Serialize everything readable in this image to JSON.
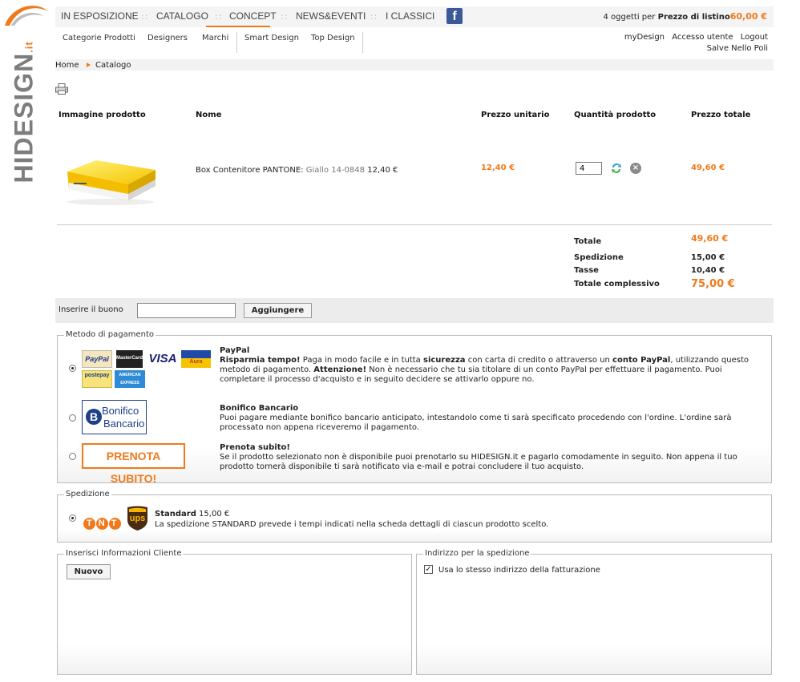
{
  "brand": {
    "name": "HIDESIGN",
    "suffix": ".it",
    "accent": "#f07a1b"
  },
  "topnav": {
    "items": [
      "IN ESPOSIZIONE",
      "CATALOGO",
      "CONCEPT",
      "NEWS&EVENTI",
      "I CLASSICI"
    ],
    "separator": "::",
    "active": "CATALOGO",
    "facebook_glyph": "f"
  },
  "cart": {
    "prefix": "4 oggetti per ",
    "label": "Prezzo di listino",
    "amount": "60,00 €"
  },
  "subnav": {
    "items": [
      "Categorie Prodotti",
      "Designers",
      "Marchi",
      "Smart Design",
      "Top Design"
    ]
  },
  "user": {
    "links": [
      "myDesign",
      "Accesso utente",
      "Logout"
    ],
    "greeting": "Salve Nello Poli"
  },
  "breadcrumb": {
    "home": "Home",
    "current": "Catalogo"
  },
  "table": {
    "headers": [
      "Immagine prodotto",
      "Nome",
      "Prezzo unitario",
      "Quantità prodotto",
      "Prezzo totale"
    ],
    "row": {
      "name": "Box Contenitore PANTONE:",
      "variant": "Giallo 14-0848",
      "inline_price": "12,40 €",
      "unit_price": "12,40 €",
      "quantity": "4",
      "total": "49,60 €"
    }
  },
  "totals": {
    "items": [
      {
        "label": "Totale",
        "value": "49,60 €"
      },
      {
        "label": "Spedizione",
        "value": "15,00 €"
      },
      {
        "label": "Tasse",
        "value": "10,40 €"
      },
      {
        "label": "Totale complessivo",
        "value": "75,00 €"
      }
    ]
  },
  "coupon": {
    "label": "Inserire il buono",
    "button": "Aggiungere",
    "value": ""
  },
  "payment": {
    "legend": "Metodo di pagamento",
    "options": [
      {
        "title": "PayPal",
        "selected": true,
        "text_parts": [
          "Risparmia tempo!",
          " Paga in modo facile e in tutta ",
          "sicurezza",
          " con carta di credito o attraverso un ",
          "conto PayPal",
          ", utilizzando questo metodo di pagamento. ",
          "Attenzione!",
          " Non è necessario che tu sia titolare di un conto PayPal per effettuare il pagamento. Puoi completare il processo d'acquisto e in seguito decidere se attivarlo oppure no."
        ],
        "logos": {
          "paypal": "PayPal",
          "mastercard": "MasterCard",
          "visa": "VISA",
          "aura": "Aura",
          "postepay": "postepay",
          "amex": "AMERICAN EXPRESS"
        }
      },
      {
        "title": "Bonifico Bancario",
        "selected": false,
        "text": "Puoi pagare mediante bonifico bancario anticipato, intestandolo come ti sarà specificato procedendo con l'ordine. L'ordine sarà processato non appena riceveremo il pagamento.",
        "logo": [
          "Bonifico",
          "Bancario"
        ]
      },
      {
        "title": "Prenota subito!",
        "selected": false,
        "text": "Se il prodotto selezionato non è disponibile puoi prenotarlo su HIDESIGN.it e pagarlo comodamente in seguito. Non appena il tuo prodotto tornerà disponibile ti sarà notificato via e-mail e potrai concludere il tuo acquisto.",
        "logo": "PRENOTA SUBITO!"
      }
    ]
  },
  "shipping": {
    "legend": "Spedizione",
    "option": {
      "title": "Standard",
      "price": "15,00 €",
      "text": "La spedizione STANDARD prevede i tempi indicati nella scheda dettagli di ciascun prodotto scelto.",
      "selected": true
    },
    "logos": {
      "tnt": "TNT",
      "ups": "ups"
    }
  },
  "customer": {
    "legend": "Inserisci Informazioni Cliente",
    "button": "Nuovo"
  },
  "address": {
    "legend": "Indirizzo per la spedizione",
    "checkbox_label": "Usa lo stesso indirizzo della fatturazione",
    "checked": true
  }
}
